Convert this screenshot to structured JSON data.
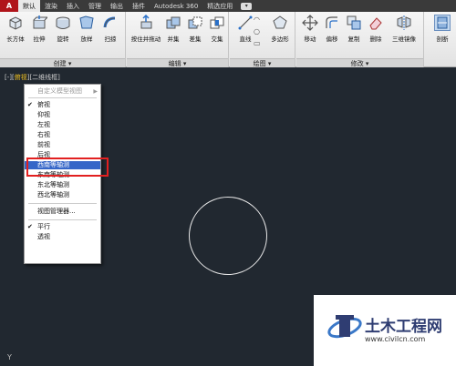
{
  "menubar": {
    "app_letter": "A",
    "tabs": [
      "默认",
      "渲染",
      "插入",
      "管理",
      "输出",
      "插件",
      "Autodesk 360",
      "精选应用"
    ],
    "extra": "▾"
  },
  "ribbon": {
    "create": {
      "title": "创建 ▾",
      "tools": [
        "长方体",
        "拉伸",
        "旋转",
        "放样",
        "扫掠"
      ]
    },
    "edit": {
      "title": "编辑 ▾",
      "tools": [
        "按住并拖动",
        "并集",
        "差集",
        "交集"
      ]
    },
    "draw": {
      "title": "绘图 ▾",
      "tools": [
        "直线",
        "多边形"
      ]
    },
    "modify": {
      "title": "修改 ▾",
      "tools": [
        "移动",
        "偏移",
        "复制",
        "删除",
        "三维镜像"
      ]
    },
    "extra_tool": "剖断"
  },
  "viewport": {
    "label_prefix": "[-][",
    "label_view": "俯视",
    "label_suffix": "][二维线框]"
  },
  "context_menu": {
    "header": "自定义模型视图",
    "items": [
      "俯视",
      "仰视",
      "左视",
      "右视",
      "前视",
      "后视",
      "西南等轴测",
      "东南等轴测",
      "东北等轴测",
      "西北等轴测"
    ],
    "view_manager": "视图管理器...",
    "projection": [
      "平行",
      "透视"
    ],
    "check": "✔"
  },
  "watermark": {
    "title": "土木工程网",
    "url": "www.civilcn.com"
  },
  "ucs_label": "Y"
}
